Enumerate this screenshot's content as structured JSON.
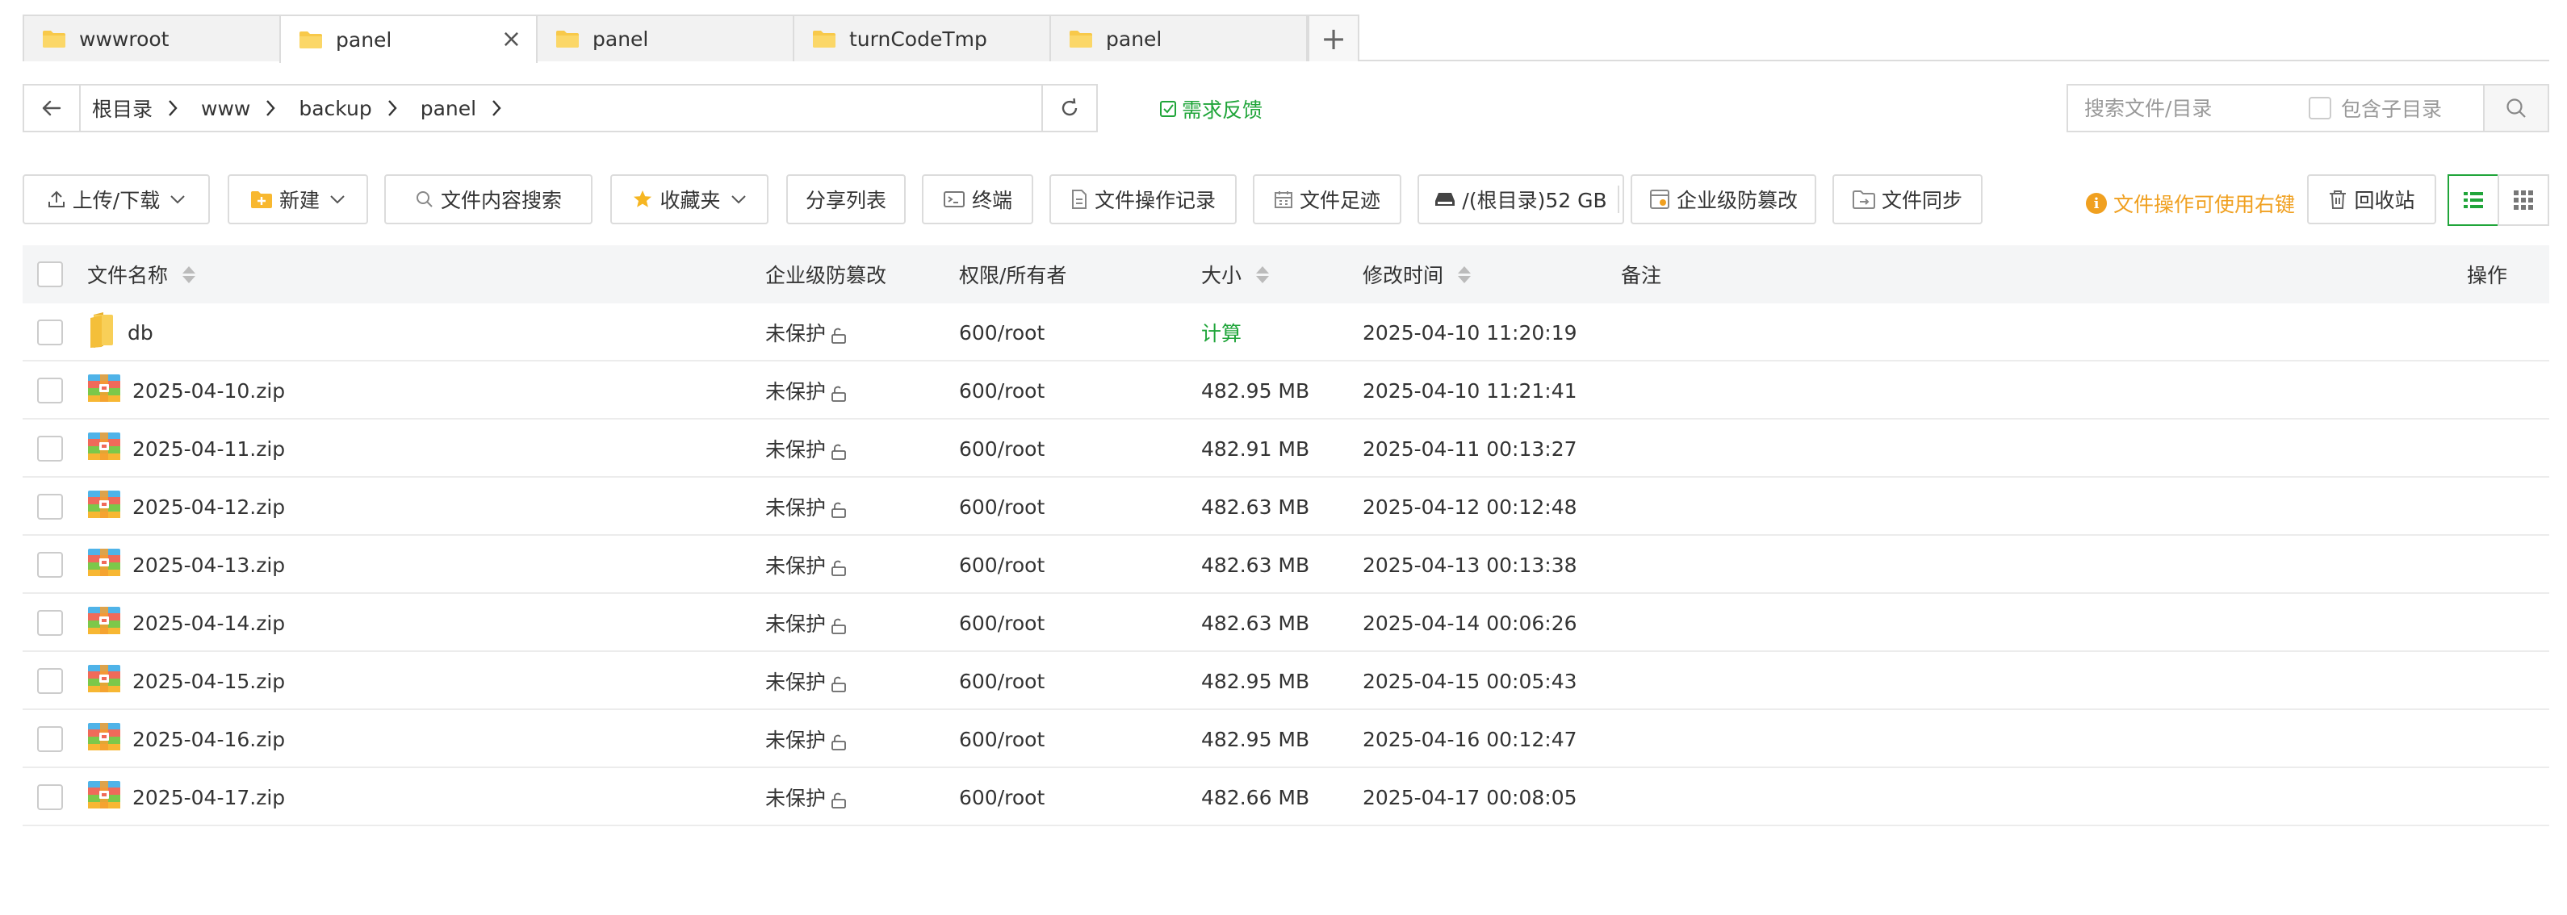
{
  "tabs": [
    {
      "label": "wwwroot",
      "active": false
    },
    {
      "label": "panel",
      "active": true
    },
    {
      "label": "panel",
      "active": false
    },
    {
      "label": "turnCodeTmp",
      "active": false
    },
    {
      "label": "panel",
      "active": false
    }
  ],
  "breadcrumb": [
    "根目录",
    "www",
    "backup",
    "panel"
  ],
  "feedback_label": "需求反馈",
  "search": {
    "placeholder": "搜索文件/目录",
    "subdir_label": "包含子目录"
  },
  "toolbar": {
    "upload": "上传/下载",
    "new": "新建",
    "content_search": "文件内容搜索",
    "favorites": "收藏夹",
    "share_list": "分享列表",
    "terminal": "终端",
    "op_log": "文件操作记录",
    "footprint": "文件足迹",
    "disk": "/(根目录)52 GB",
    "tamper": "企业级防篡改",
    "sync": "文件同步",
    "tip": "文件操作可使用右键",
    "recycle": "回收站"
  },
  "table": {
    "headers": {
      "name": "文件名称",
      "tamper": "企业级防篡改",
      "perm": "权限/所有者",
      "size": "大小",
      "mtime": "修改时间",
      "note": "备注",
      "ops": "操作"
    },
    "rows": [
      {
        "name": "db",
        "type": "folder",
        "tamper": "未保护",
        "perm": "600/root",
        "size": "计算",
        "mtime": "2025-04-10 11:20:19"
      },
      {
        "name": "2025-04-10.zip",
        "type": "zip",
        "tamper": "未保护",
        "perm": "600/root",
        "size": "482.95 MB",
        "mtime": "2025-04-10 11:21:41"
      },
      {
        "name": "2025-04-11.zip",
        "type": "zip",
        "tamper": "未保护",
        "perm": "600/root",
        "size": "482.91 MB",
        "mtime": "2025-04-11 00:13:27"
      },
      {
        "name": "2025-04-12.zip",
        "type": "zip",
        "tamper": "未保护",
        "perm": "600/root",
        "size": "482.63 MB",
        "mtime": "2025-04-12 00:12:48"
      },
      {
        "name": "2025-04-13.zip",
        "type": "zip",
        "tamper": "未保护",
        "perm": "600/root",
        "size": "482.63 MB",
        "mtime": "2025-04-13 00:13:38"
      },
      {
        "name": "2025-04-14.zip",
        "type": "zip",
        "tamper": "未保护",
        "perm": "600/root",
        "size": "482.63 MB",
        "mtime": "2025-04-14 00:06:26"
      },
      {
        "name": "2025-04-15.zip",
        "type": "zip",
        "tamper": "未保护",
        "perm": "600/root",
        "size": "482.95 MB",
        "mtime": "2025-04-15 00:05:43"
      },
      {
        "name": "2025-04-16.zip",
        "type": "zip",
        "tamper": "未保护",
        "perm": "600/root",
        "size": "482.95 MB",
        "mtime": "2025-04-16 00:12:47"
      },
      {
        "name": "2025-04-17.zip",
        "type": "zip",
        "tamper": "未保护",
        "perm": "600/root",
        "size": "482.66 MB",
        "mtime": "2025-04-17 00:08:05"
      }
    ]
  },
  "colors": {
    "accent": "#20a53a",
    "tip": "#f0a020",
    "border": "#dcdcdc",
    "header_bg": "#f4f5f6"
  }
}
